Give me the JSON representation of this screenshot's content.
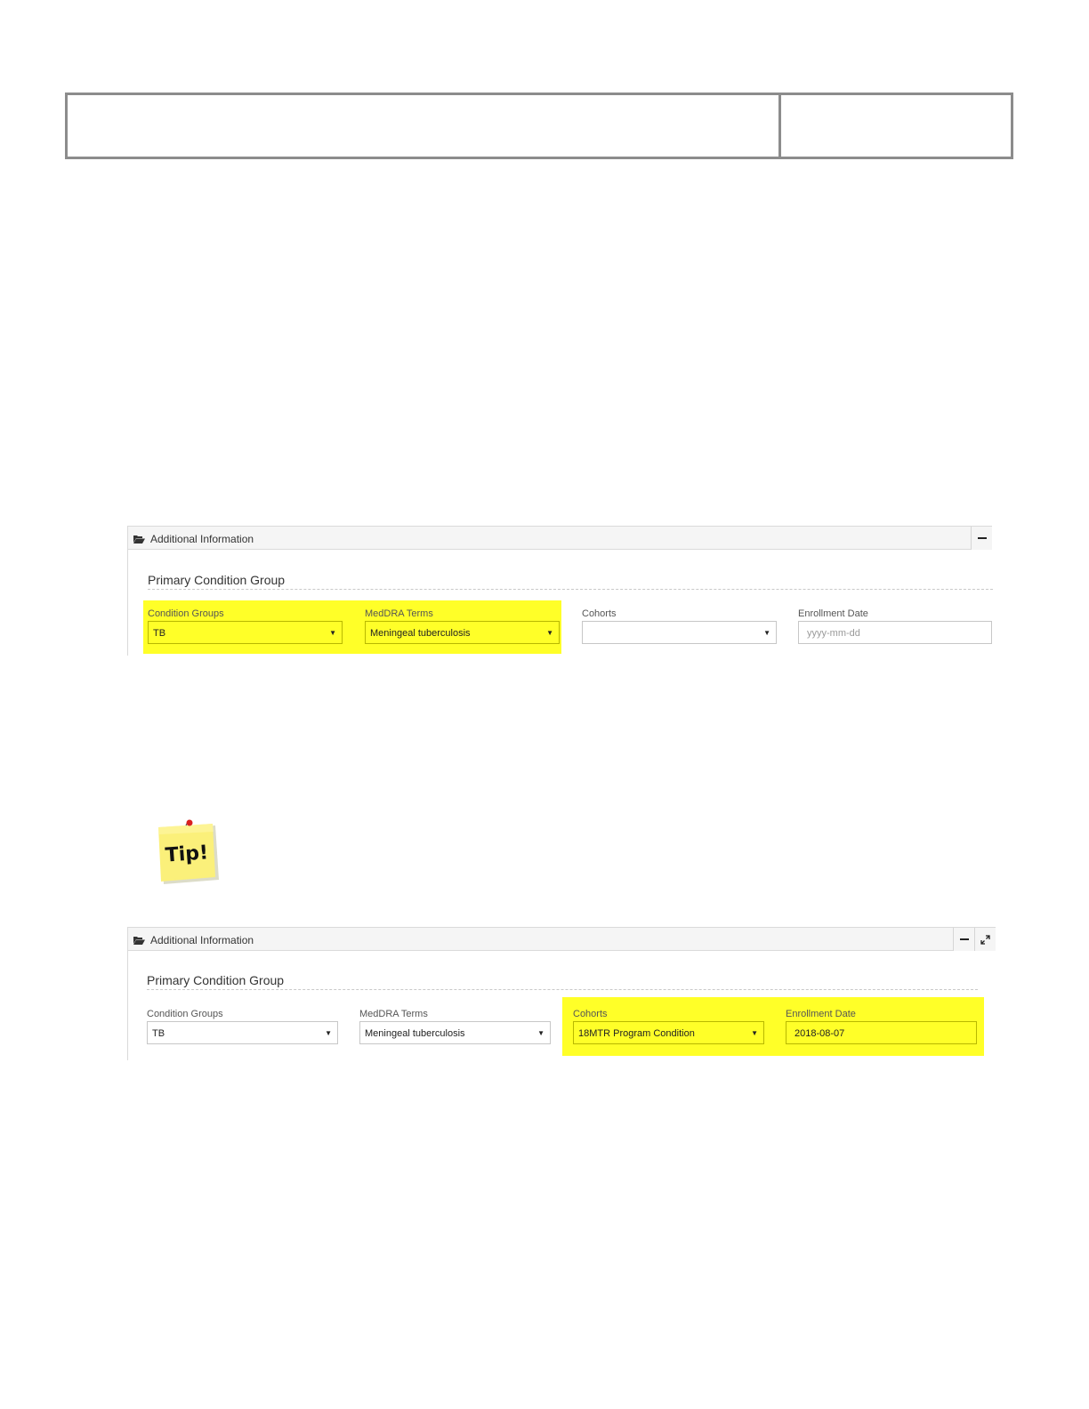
{
  "panel1": {
    "title": "Additional Information",
    "section_title": "Primary Condition Group",
    "fields": [
      {
        "label": "Condition Groups",
        "value": "TB",
        "kind": "select"
      },
      {
        "label": "MedDRA Terms",
        "value": "Meningeal tuberculosis",
        "kind": "select"
      },
      {
        "label": "Cohorts",
        "value": "",
        "kind": "select"
      },
      {
        "label": "Enrollment Date",
        "placeholder": "yyyy-mm-dd",
        "kind": "date"
      }
    ],
    "highlighted_fields": [
      "Condition Groups",
      "MedDRA Terms"
    ]
  },
  "tip": {
    "label": "Tip!"
  },
  "panel2": {
    "title": "Additional Information",
    "section_title": "Primary Condition Group",
    "fields": [
      {
        "label": "Condition Groups",
        "value": "TB",
        "kind": "select"
      },
      {
        "label": "MedDRA Terms",
        "value": "Meningeal tuberculosis",
        "kind": "select"
      },
      {
        "label": "Cohorts",
        "value": "18MTR Program Condition",
        "kind": "select"
      },
      {
        "label": "Enrollment Date",
        "value": "2018-08-07",
        "kind": "date"
      }
    ],
    "highlighted_fields": [
      "Cohorts",
      "Enrollment Date"
    ]
  },
  "icons": {
    "folder": "folder-open-icon",
    "minimize": "minus-icon",
    "expand": "expand-icon",
    "dropdown": "caret-down-icon"
  },
  "colors": {
    "highlight": "#ffff28"
  }
}
